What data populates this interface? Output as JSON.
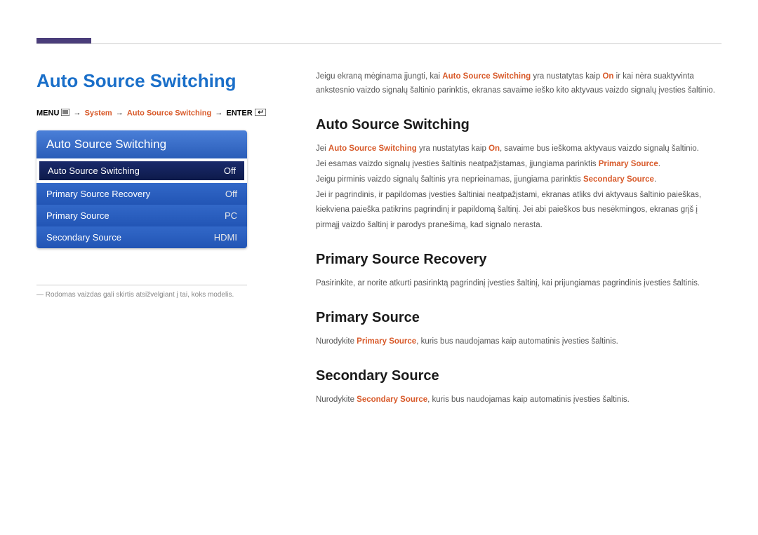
{
  "page_title": "Auto Source Switching",
  "breadcrumb": {
    "menu": "MENU",
    "system": "System",
    "auto": "Auto Source Switching",
    "enter": "ENTER"
  },
  "osd": {
    "header": "Auto Source Switching",
    "items": [
      {
        "label": "Auto Source Switching",
        "value": "Off",
        "selected": true
      },
      {
        "label": "Primary Source Recovery",
        "value": "Off",
        "selected": false
      },
      {
        "label": "Primary Source",
        "value": "PC",
        "selected": false
      },
      {
        "label": "Secondary Source",
        "value": "HDMI",
        "selected": false
      }
    ]
  },
  "footnote": "― Rodomas vaizdas gali skirtis atsižvelgiant į tai, koks modelis.",
  "intro": {
    "p1a": "Jeigu ekraną mėginama įjungti, kai ",
    "hl1": "Auto Source Switching",
    "p1b": " yra nustatytas kaip ",
    "hl2": "On",
    "p1c": " ir kai nėra suaktyvinta ankstesnio vaizdo signalų šaltinio parinktis, ekranas savaime ieško kito aktyvaus vaizdo signalų įvesties šaltinio."
  },
  "sections": {
    "s1": {
      "heading": "Auto Source Switching",
      "l1a": "Jei ",
      "l1hl1": "Auto Source Switching",
      "l1b": " yra nustatytas kaip ",
      "l1hl2": "On",
      "l1c": ", savaime bus ieškoma aktyvaus vaizdo signalų šaltinio.",
      "l2a": "Jei esamas vaizdo signalų įvesties šaltinis neatpažįstamas, įjungiama parinktis ",
      "l2hl": "Primary Source",
      "l2b": ".",
      "l3a": "Jeigu pirminis vaizdo signalų šaltinis yra neprieinamas, įjungiama parinktis ",
      "l3hl": "Secondary Source",
      "l3b": ".",
      "l4": "Jei ir pagrindinis, ir papildomas įvesties šaltiniai neatpažįstami, ekranas atliks dvi aktyvaus šaltinio paieškas, kiekviena paieška patikrins pagrindinį ir papildomą šaltinį. Jei abi paieškos bus nesėkmingos, ekranas grįš į pirmąjį vaizdo šaltinį ir parodys pranešimą, kad signalo nerasta."
    },
    "s2": {
      "heading": "Primary Source Recovery",
      "body": "Pasirinkite, ar norite atkurti pasirinktą pagrindinį įvesties šaltinį, kai prijungiamas pagrindinis įvesties šaltinis."
    },
    "s3": {
      "heading": "Primary Source",
      "a": "Nurodykite ",
      "hl": "Primary Source",
      "b": ", kuris bus naudojamas kaip automatinis įvesties šaltinis."
    },
    "s4": {
      "heading": "Secondary Source",
      "a": "Nurodykite ",
      "hl": "Secondary Source",
      "b": ", kuris bus naudojamas kaip automatinis įvesties šaltinis."
    }
  }
}
